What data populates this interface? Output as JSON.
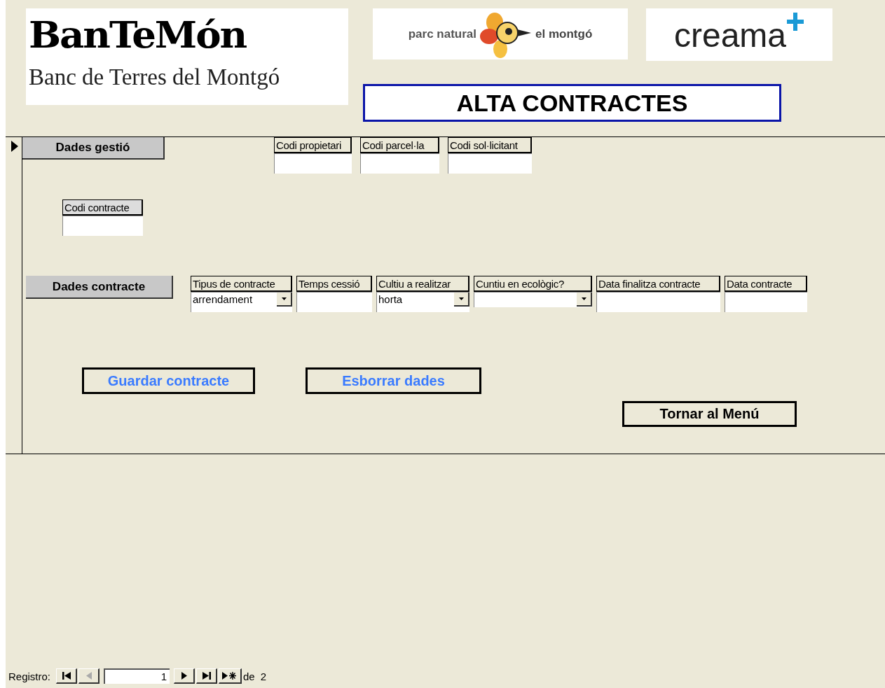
{
  "header": {
    "logo": "BanTeMón",
    "subtitle": "Banc de Terres del Montgó",
    "partner_logo": {
      "left": "parc natural",
      "right": "el montgó"
    },
    "sponsor_logo": "creama",
    "title": "ALTA CONTRACTES"
  },
  "management": {
    "heading": "Dades gestió",
    "fields": [
      {
        "label": "Codi propietari",
        "kind": "text"
      },
      {
        "label": "Codi parcel·la",
        "kind": "text"
      },
      {
        "label": "Codi sol·licitant",
        "kind": "text"
      }
    ],
    "contract_code": {
      "label": "Codi contracte",
      "kind": "text"
    }
  },
  "contract": {
    "heading": "Dades contracte",
    "fields": [
      {
        "label": "Tipus de contracte",
        "kind": "combo",
        "value": "arrendament"
      },
      {
        "label": "Temps cessió",
        "kind": "text"
      },
      {
        "label": "Cultiu a realitzar",
        "kind": "combo",
        "value": "horta"
      },
      {
        "label": "Cuntiu en ecològic?",
        "kind": "combo"
      },
      {
        "label": "Data finalitza contracte",
        "kind": "text"
      },
      {
        "label": "Data contracte",
        "kind": "text"
      }
    ]
  },
  "buttons": [
    {
      "label": "Guardar contracte",
      "kind": "action"
    },
    {
      "label": "Esborrar dades",
      "kind": "action"
    },
    {
      "label": "Tornar al Menú",
      "kind": "navigation"
    }
  ],
  "record_nav": {
    "label": "Registro:",
    "current": "1",
    "of_label": "de",
    "total": "2",
    "buttons": [
      {
        "kind": "first",
        "disabled": false
      },
      {
        "kind": "previous",
        "disabled": true
      },
      {
        "kind": "next",
        "disabled": false
      },
      {
        "kind": "last",
        "disabled": false
      },
      {
        "kind": "new",
        "disabled": false
      }
    ]
  }
}
